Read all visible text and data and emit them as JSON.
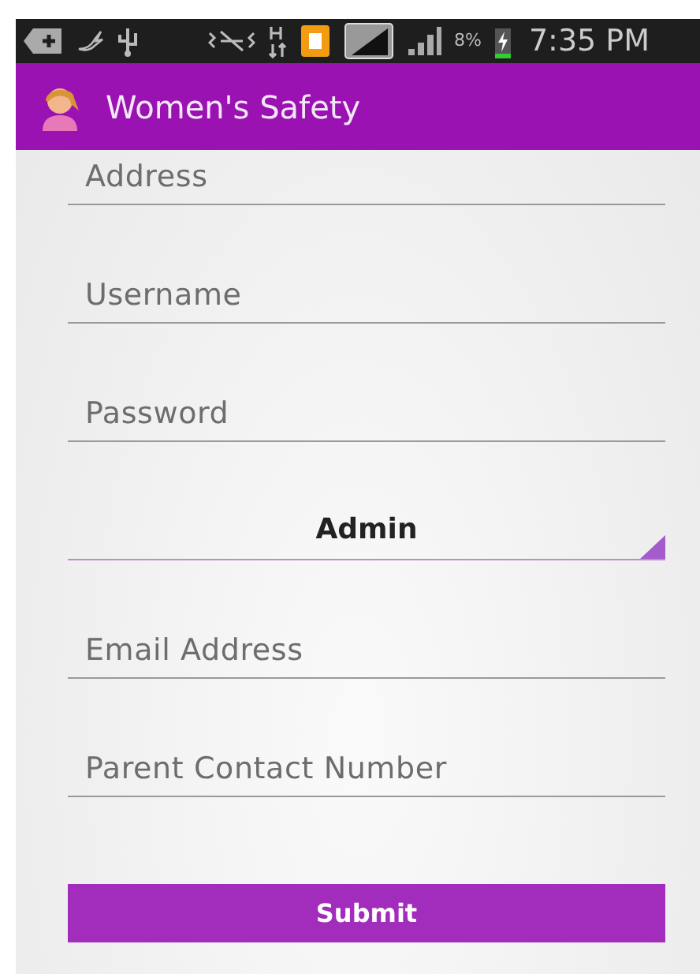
{
  "status_bar": {
    "battery": "8%",
    "time": "7:35 PM"
  },
  "app_bar": {
    "title": "Women's Safety"
  },
  "form": {
    "fields": [
      {
        "placeholder": "Address"
      },
      {
        "placeholder": "Username"
      },
      {
        "placeholder": "Password"
      },
      {
        "kind": "spinner",
        "value": "Admin"
      },
      {
        "placeholder": "Email Address"
      },
      {
        "placeholder": "Parent Contact Number"
      }
    ],
    "submit": "Submit"
  }
}
